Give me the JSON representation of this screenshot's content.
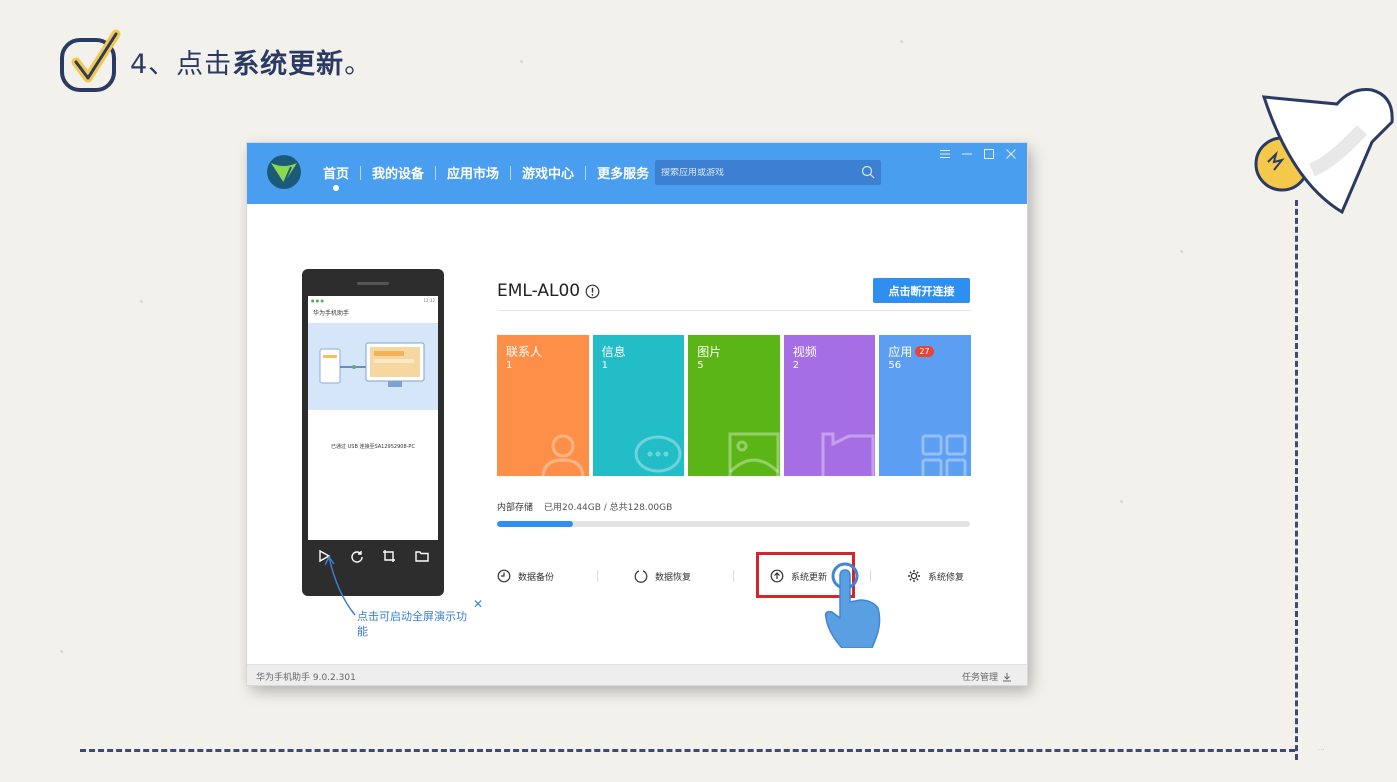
{
  "slide": {
    "step_prefix": "4、点击",
    "step_bold": "系统更新",
    "step_suffix": "。",
    "watermark": "..."
  },
  "app": {
    "nav": [
      {
        "label": "首页",
        "active": true
      },
      {
        "label": "我的设备"
      },
      {
        "label": "应用市场"
      },
      {
        "label": "游戏中心"
      },
      {
        "label": "更多服务"
      }
    ],
    "search": {
      "placeholder": "搜索应用或游戏"
    },
    "phone": {
      "status_time": "12:32",
      "app_title": "华为手机助手",
      "message": "已通过 USB 连接至SA12952908-PC",
      "hint": "点击可启动全屏演示功能"
    },
    "device": {
      "name": "EML-AL00",
      "reconnect_label": "点击断开连接"
    },
    "tiles": [
      {
        "label": "联系人",
        "count": "1",
        "color": "#fd8f48",
        "icon": "contact-icon"
      },
      {
        "label": "信息",
        "count": "1",
        "color": "#22bdc7",
        "icon": "message-icon"
      },
      {
        "label": "图片",
        "count": "5",
        "color": "#5cb517",
        "icon": "picture-icon"
      },
      {
        "label": "视频",
        "count": "2",
        "color": "#a56ee4",
        "icon": "video-icon"
      },
      {
        "label": "应用",
        "count": "56",
        "badge": "27",
        "color": "#5c9ef2",
        "icon": "apps-icon"
      }
    ],
    "storage": {
      "label": "内部存储",
      "used_text": "已用20.44GB / 总共128.00GB",
      "used_fraction": 0.16
    },
    "actions": [
      {
        "label": "数据备份",
        "icon": "backup-icon"
      },
      {
        "label": "数据恢复",
        "icon": "restore-icon"
      },
      {
        "label": "系统更新",
        "icon": "update-icon",
        "highlighted": true
      },
      {
        "label": "系统修复",
        "icon": "repair-icon"
      }
    ],
    "status_bar": {
      "version": "华为手机助手 9.0.2.301",
      "task_manager": "任务管理"
    }
  }
}
